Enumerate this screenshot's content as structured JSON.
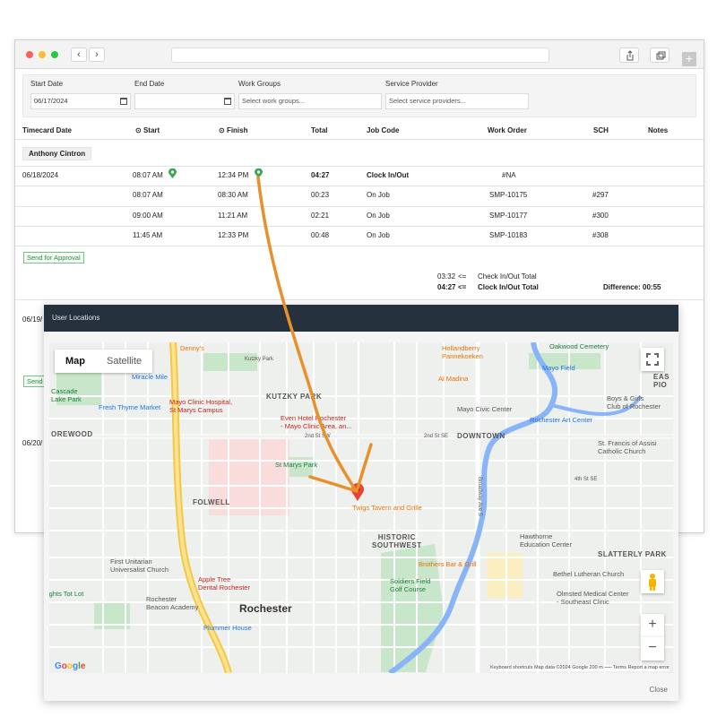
{
  "filters": {
    "start_date_label": "Start Date",
    "start_date_value": "06/17/2024",
    "end_date_label": "End Date",
    "end_date_value": "",
    "work_groups_label": "Work Groups",
    "work_groups_placeholder": "Select work groups...",
    "service_provider_label": "Service Provider",
    "service_provider_placeholder": "Select service providers..."
  },
  "table": {
    "headers": [
      "Timecard Date",
      "Start",
      "Finish",
      "Total",
      "Job Code",
      "Work Order",
      "SCH",
      "Notes"
    ],
    "employee": "Anthony Cintron",
    "rows": [
      {
        "date": "06/18/2024",
        "start": "08:07 AM",
        "finish": "12:34 PM",
        "total": "04:27",
        "job": "Clock In/Out",
        "order": "#NA",
        "sch": ""
      },
      {
        "date": "",
        "start": "08:07 AM",
        "finish": "08:30 AM",
        "total": "00:23",
        "job": "On Job",
        "order": "SMP-10175",
        "sch": "#297"
      },
      {
        "date": "",
        "start": "09:00 AM",
        "finish": "11:21 AM",
        "total": "02:21",
        "job": "On Job",
        "order": "SMP-10177",
        "sch": "#300"
      },
      {
        "date": "",
        "start": "11:45 AM",
        "finish": "12:33 PM",
        "total": "00:48",
        "job": "On Job",
        "order": "SMP-10183",
        "sch": "#308"
      }
    ],
    "send_for_approval": "Send for Approval",
    "send_short": "Send",
    "summary": {
      "check_total_value": "03:32",
      "check_total_arrow": "<=",
      "check_total_label": "Check In/Out Total",
      "clock_total_value": "04:27",
      "clock_total_arrow": "<=",
      "clock_total_label": "Clock In/Out Total",
      "difference_label": "Difference: 00:55"
    },
    "other_dates": [
      "06/19/",
      "06/20/"
    ]
  },
  "modal": {
    "title": "User Locations",
    "close_label": "Close",
    "map_type_map": "Map",
    "map_type_satellite": "Satellite",
    "zoom_in": "+",
    "zoom_out": "−",
    "footer": "Keyboard shortcuts    Map data ©2024 Google    200 m ⎯⎯⎯    Terms    Report a map error",
    "google": "Google",
    "labels": {
      "dennys": "Denny's",
      "kutzky_park_road": "Kutzky Park",
      "miracle_mile": "Miracle Mile",
      "cascade_lake_park": "Cascade\nLake Park",
      "fresh_thyme": "Fresh Thyme Market",
      "kutzky_park": "KUTZKY PARK",
      "mayo_hospital": "Mayo Clinic Hospital,\nSt Marys Campus",
      "even_hotel": "Even Hotel Rochester\n- Mayo Clinic Area, an...",
      "orewood": "OREWOOD",
      "folwell": "FOLWELL",
      "st_marys_park": "St Marys Park",
      "twigs": "Twigs Tavern and Grille",
      "historic_sw": "HISTORIC\nSOUTHWEST",
      "first_unitarian": "First Unitarian\nUniversalist Church",
      "apple_tree": "Apple Tree\nDental Rochester",
      "heights_tot_lot": "ights Tot Lot",
      "beacon": "Rochester\nBeacon Academy",
      "rochester": "Rochester",
      "plummer": "Plummer House",
      "hollandberry": "Hollandberry\nPannekoeken",
      "al_madina": "Al Madina",
      "mayo_civic": "Mayo Civic Center",
      "downtown": "DOWNTOWN",
      "oakwood": "Oakwood Cemetery",
      "mayo_field": "Mayo Field",
      "east_pio": "EAS\nPIO",
      "boys_girls": "Boys & Girls\nClub of Rochester",
      "art_center": "Rochester Art Center",
      "st_francis": "St. Francis of Assisi\nCatholic Church",
      "hawthorne": "Hawthorne\nEducation Center",
      "slatterly": "SLATTERLY PARK",
      "bethel": "Bethel Lutheran Church",
      "brothers": "Brothers Bar & Grill",
      "soldiers": "Soldiers Field\nGolf Course",
      "olmsted": "Olmsted Medical Center\n- Southeast Clinic",
      "second_st_sw": "2nd St SW",
      "second_st_se": "2nd St SE",
      "fourth_st_se": "4th St SE",
      "broadway": "Broadway Ave S"
    }
  },
  "colors": {
    "accent_orange": "#e8902c",
    "pin_green": "#3aa853",
    "pin_red": "#ea4335",
    "modal_header": "#25313d",
    "approve_green": "#2e8b3e"
  }
}
